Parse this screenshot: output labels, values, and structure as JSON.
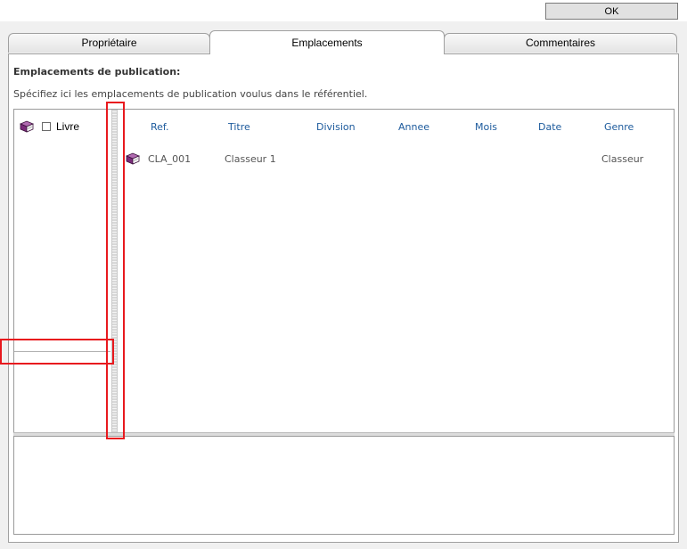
{
  "toolbar": {
    "ok_label": "OK"
  },
  "tabs": [
    {
      "label": "Propriétaire",
      "active": false
    },
    {
      "label": "Emplacements",
      "active": true
    },
    {
      "label": "Commentaires",
      "active": false
    }
  ],
  "section": {
    "heading": "Emplacements de publication:",
    "description": "Spécifiez ici les emplacements de publication voulus dans le référentiel."
  },
  "tree": {
    "items": [
      {
        "label": "Livre",
        "checked": false,
        "icon": "book-icon"
      }
    ]
  },
  "table": {
    "columns": [
      "Ref.",
      "Titre",
      "Division",
      "Annee",
      "Mois",
      "Date",
      "Genre"
    ],
    "rows": [
      {
        "icon": "book-icon",
        "ref": "CLA_001",
        "titre": "Classeur 1",
        "division": "",
        "annee": "",
        "mois": "",
        "date": "",
        "genre": "Classeur"
      }
    ]
  },
  "colors": {
    "header_link": "#1c5a9c",
    "highlight": "#e8191e",
    "book_icon": "#7a2a7a"
  }
}
